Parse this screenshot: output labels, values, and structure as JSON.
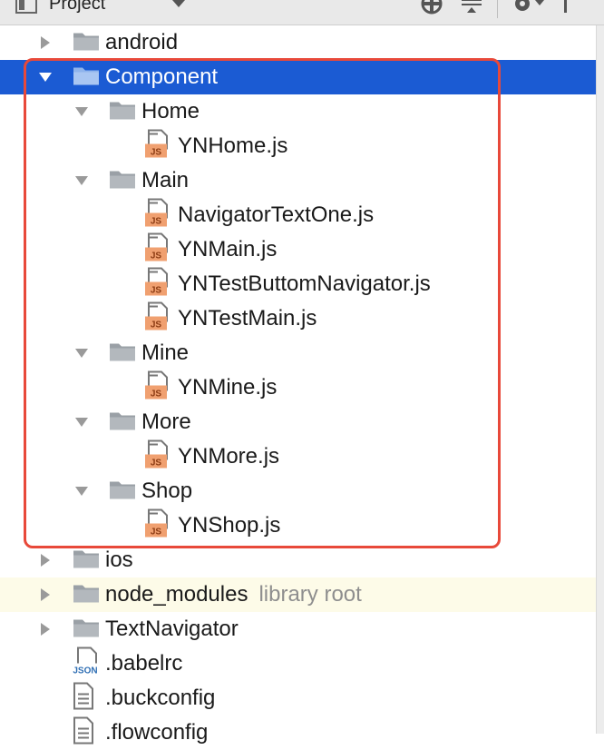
{
  "toolbar": {
    "title": "Project"
  },
  "tree": [
    {
      "label": "android",
      "kind": "folder",
      "depth": 0,
      "expanded": false
    },
    {
      "label": "Component",
      "kind": "folder",
      "depth": 0,
      "expanded": true,
      "selected": true
    },
    {
      "label": "Home",
      "kind": "folder",
      "depth": 1,
      "expanded": true
    },
    {
      "label": "YNHome.js",
      "kind": "js",
      "depth": 2
    },
    {
      "label": "Main",
      "kind": "folder",
      "depth": 1,
      "expanded": true
    },
    {
      "label": "NavigatorTextOne.js",
      "kind": "js",
      "depth": 2
    },
    {
      "label": "YNMain.js",
      "kind": "js",
      "depth": 2
    },
    {
      "label": "YNTestButtomNavigator.js",
      "kind": "js",
      "depth": 2
    },
    {
      "label": "YNTestMain.js",
      "kind": "js",
      "depth": 2
    },
    {
      "label": "Mine",
      "kind": "folder",
      "depth": 1,
      "expanded": true
    },
    {
      "label": "YNMine.js",
      "kind": "js",
      "depth": 2
    },
    {
      "label": "More",
      "kind": "folder",
      "depth": 1,
      "expanded": true
    },
    {
      "label": "YNMore.js",
      "kind": "js",
      "depth": 2
    },
    {
      "label": "Shop",
      "kind": "folder",
      "depth": 1,
      "expanded": true
    },
    {
      "label": "YNShop.js",
      "kind": "js",
      "depth": 2
    },
    {
      "label": "ios",
      "kind": "folder",
      "depth": 0,
      "expanded": false
    },
    {
      "label": "node_modules",
      "kind": "folder",
      "depth": 0,
      "expanded": false,
      "tag": "library root"
    },
    {
      "label": "TextNavigator",
      "kind": "folder",
      "depth": 0,
      "expanded": false
    },
    {
      "label": ".babelrc",
      "kind": "json",
      "depth": 0
    },
    {
      "label": ".buckconfig",
      "kind": "text",
      "depth": 0
    },
    {
      "label": ".flowconfig",
      "kind": "text",
      "depth": 0
    }
  ],
  "colors": {
    "selection": "#1b5bd3",
    "highlight_border": "#e8493a",
    "library_row": "#fdfbe8",
    "folder": "#9aa0a6",
    "js_badge": "#f0a070",
    "json_badge": "#5a8fc8"
  },
  "icons": {
    "toolbar": [
      "project-view-icon",
      "chevron-down-icon",
      "locate-icon",
      "collapse-all-icon",
      "gear-icon",
      "hide-icon"
    ],
    "folder": "folder-icon",
    "js": "js-file-icon",
    "json": "json-file-icon",
    "text": "text-file-icon",
    "collapsed": "chevron-right-icon",
    "expanded": "chevron-down-icon"
  }
}
